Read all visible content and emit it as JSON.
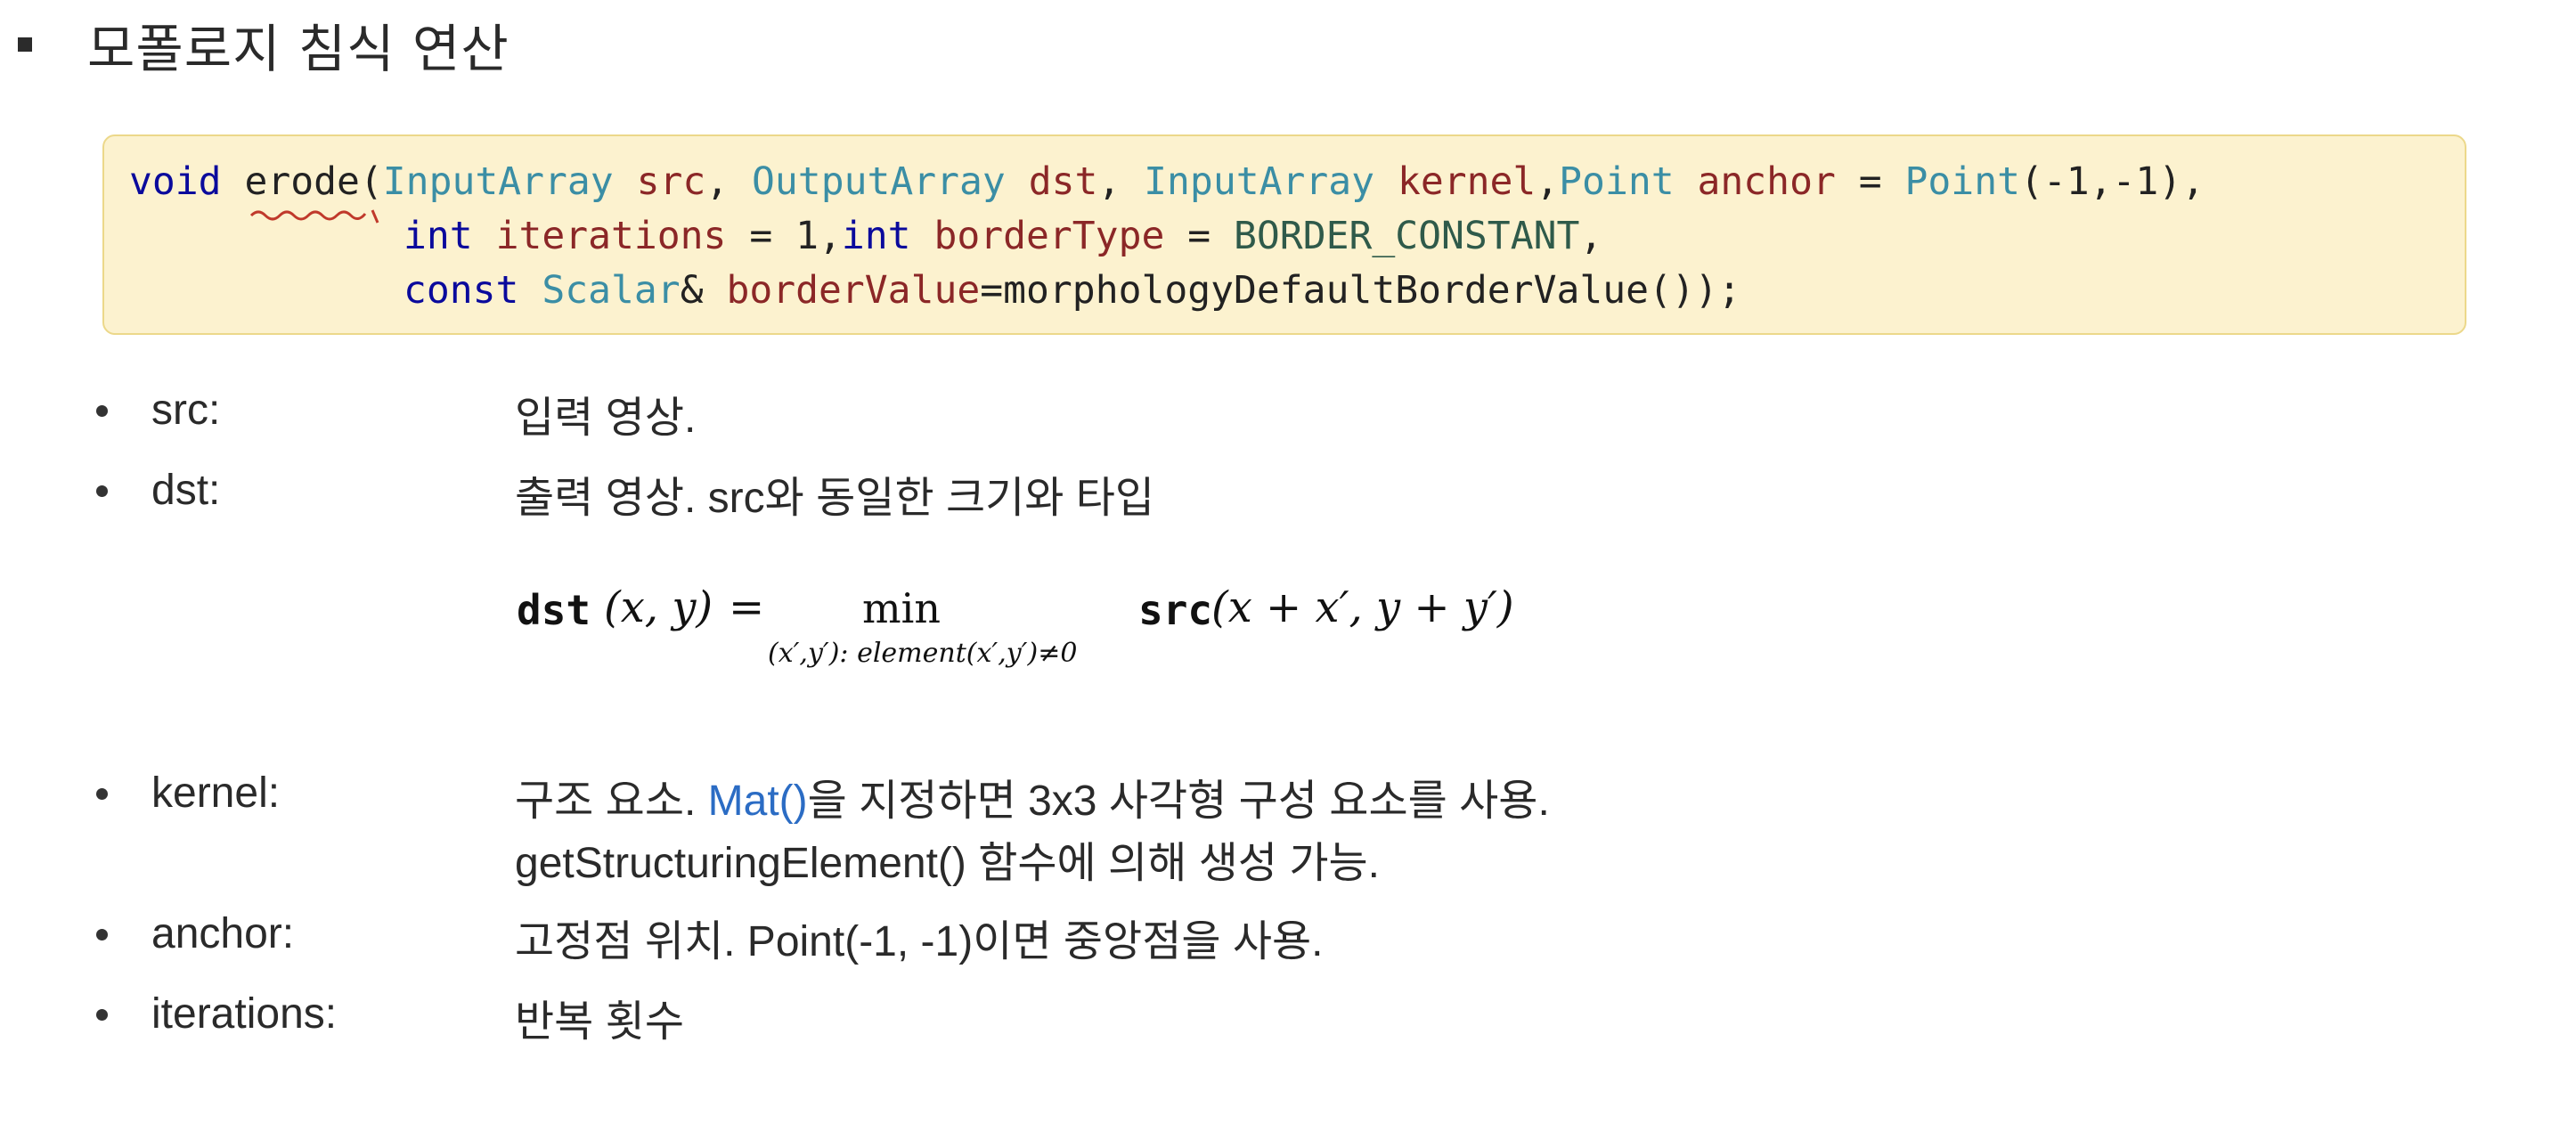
{
  "title": "모폴로지 침식 연산",
  "code": {
    "line1": [
      {
        "t": "void",
        "c": "kw"
      },
      {
        "t": " ",
        "c": "fn"
      },
      {
        "t": "erode",
        "c": "fn"
      },
      {
        "t": "(",
        "c": "fn"
      },
      {
        "t": "InputArray",
        "c": "ty"
      },
      {
        "t": " ",
        "c": "fn"
      },
      {
        "t": "src",
        "c": "pa"
      },
      {
        "t": ", ",
        "c": "fn"
      },
      {
        "t": "OutputArray",
        "c": "ty"
      },
      {
        "t": " ",
        "c": "fn"
      },
      {
        "t": "dst",
        "c": "pa"
      },
      {
        "t": ", ",
        "c": "fn"
      },
      {
        "t": "InputArray",
        "c": "ty"
      },
      {
        "t": " ",
        "c": "fn"
      },
      {
        "t": "kernel",
        "c": "pa"
      },
      {
        "t": ",",
        "c": "fn"
      },
      {
        "t": "Point",
        "c": "ty"
      },
      {
        "t": " ",
        "c": "fn"
      },
      {
        "t": "anchor",
        "c": "pa"
      },
      {
        "t": " = ",
        "c": "fn"
      },
      {
        "t": "Point",
        "c": "ty"
      },
      {
        "t": "(-1,-1),",
        "c": "fn"
      }
    ],
    "line2": [
      {
        "t": "int",
        "c": "kw"
      },
      {
        "t": " ",
        "c": "fn"
      },
      {
        "t": "iterations",
        "c": "pa"
      },
      {
        "t": " = 1,",
        "c": "fn"
      },
      {
        "t": "int",
        "c": "kw"
      },
      {
        "t": " ",
        "c": "fn"
      },
      {
        "t": "borderType",
        "c": "pa"
      },
      {
        "t": " = ",
        "c": "fn"
      },
      {
        "t": "BORDER_CONSTANT",
        "c": "cn"
      },
      {
        "t": ",",
        "c": "fn"
      }
    ],
    "line3": [
      {
        "t": "const",
        "c": "kw"
      },
      {
        "t": " ",
        "c": "fn"
      },
      {
        "t": "Scalar",
        "c": "ty"
      },
      {
        "t": "& ",
        "c": "fn"
      },
      {
        "t": "borderValue",
        "c": "pa"
      },
      {
        "t": "=morphologyDefaultBorderValue());",
        "c": "fn"
      }
    ]
  },
  "params": {
    "src": {
      "name": "src:",
      "desc": "입력 영상."
    },
    "dst": {
      "name": "dst:",
      "desc": "출력 영상. src와 동일한 크기와 타입"
    },
    "kernel": {
      "name": "kernel:",
      "desc_pre": "구조 요소. ",
      "desc_link": "Mat()",
      "desc_post": "을 지정하면 3x3 사각형 구성 요소를 사용.",
      "desc_line2": "getStructuringElement() 함수에 의해 생성 가능."
    },
    "anchor": {
      "name": "anchor:",
      "desc": "고정점 위치. Point(-1, -1)이면 중앙점을 사용."
    },
    "iterations": {
      "name": "iterations:",
      "desc": "반복 횟수"
    }
  },
  "formula": {
    "lhs_fn": "dst",
    "lhs_args": "(x, y)",
    "eq": "=",
    "op": "min",
    "sub": "(x′,y′): element(x′,y′)≠0",
    "rhs_fn": "src",
    "rhs_args": "(x + x′, y + y′)"
  }
}
